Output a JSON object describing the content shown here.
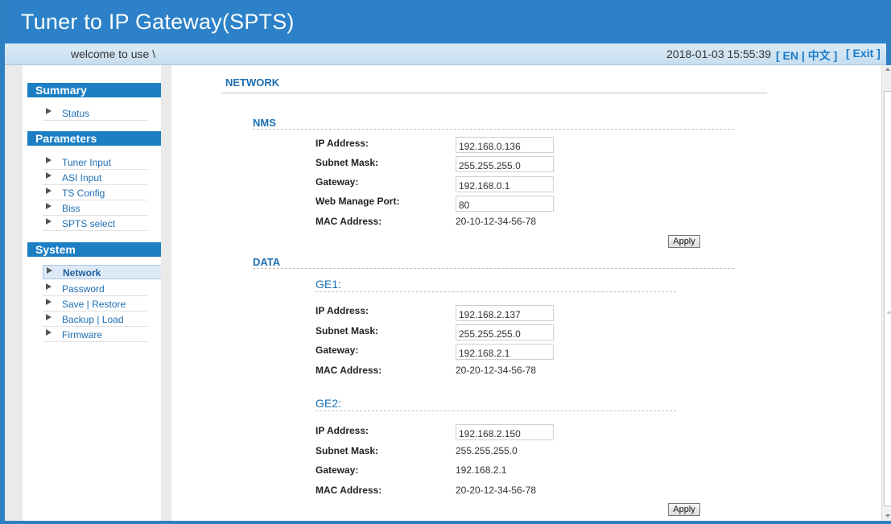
{
  "header": {
    "title": "Tuner to IP Gateway(SPTS)"
  },
  "subbar": {
    "welcome": "welcome to use \\",
    "datetime": "2018-01-03 15:55:39",
    "lang_en": "[ EN |",
    "lang_cn": "中文 ]",
    "exit": "[ Exit ]"
  },
  "sidebar": {
    "summary": {
      "title": "Summary",
      "items": [
        "Status"
      ]
    },
    "parameters": {
      "title": "Parameters",
      "items": [
        "Tuner Input",
        "ASI Input",
        "TS Config",
        "Biss",
        "SPTS select"
      ]
    },
    "system": {
      "title": "System",
      "items": [
        "Network",
        "Password",
        "Save | Restore",
        "Backup | Load",
        "Firmware"
      ]
    }
  },
  "content": {
    "heading": "NETWORK",
    "nms": {
      "title": "NMS",
      "ip_label": "IP Address:",
      "ip": "192.168.0.136",
      "mask_label": "Subnet Mask:",
      "mask": "255.255.255.0",
      "gw_label": "Gateway:",
      "gw": "192.168.0.1",
      "port_label": "Web Manage Port:",
      "port": "80",
      "mac_label": "MAC Address:",
      "mac": "20-10-12-34-56-78",
      "apply": "Apply"
    },
    "data": {
      "title": "DATA",
      "ge1": {
        "title": "GE1:",
        "ip_label": "IP Address:",
        "ip": "192.168.2.137",
        "mask_label": "Subnet Mask:",
        "mask": "255.255.255.0",
        "gw_label": "Gateway:",
        "gw": "192.168.2.1",
        "mac_label": "MAC Address:",
        "mac": "20-20-12-34-56-78"
      },
      "ge2": {
        "title": "GE2:",
        "ip_label": "IP Address:",
        "ip": "192.168.2.150",
        "mask_label": "Subnet Mask:",
        "mask": "255.255.255.0",
        "gw_label": "Gateway:",
        "gw": "192.168.2.1",
        "mac_label": "MAC Address:",
        "mac": "20-20-12-34-56-78"
      },
      "apply": "Apply"
    }
  }
}
